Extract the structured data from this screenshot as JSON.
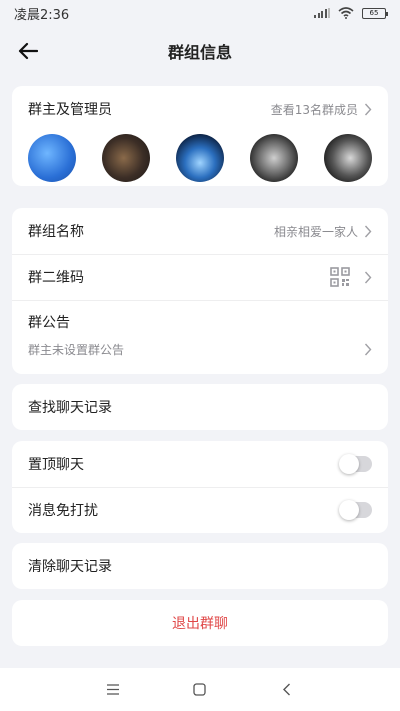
{
  "status_bar": {
    "time": "凌晨2:36",
    "battery": "65",
    "icons": [
      "signal-icon",
      "wifi-icon",
      "battery-icon"
    ]
  },
  "header": {
    "title": "群组信息",
    "back_icon": "arrow-left-icon"
  },
  "members": {
    "label": "群主及管理员",
    "view_all": "查看13名群成员",
    "avatars": [
      "avatar-1",
      "avatar-2",
      "avatar-3",
      "avatar-4",
      "avatar-5"
    ]
  },
  "group": {
    "name_label": "群组名称",
    "name_value": "相亲相爱一家人",
    "qr_label": "群二维码",
    "notice_label": "群公告",
    "notice_value": "群主未设置群公告"
  },
  "search": {
    "label": "查找聊天记录"
  },
  "settings": {
    "pin_label": "置顶聊天",
    "pin_on": false,
    "mute_label": "消息免打扰",
    "mute_on": false
  },
  "clear": {
    "label": "清除聊天记录"
  },
  "exit": {
    "label": "退出群聊",
    "color": "#e04848"
  },
  "system_nav": [
    "menu-icon",
    "home-icon",
    "back-icon"
  ]
}
